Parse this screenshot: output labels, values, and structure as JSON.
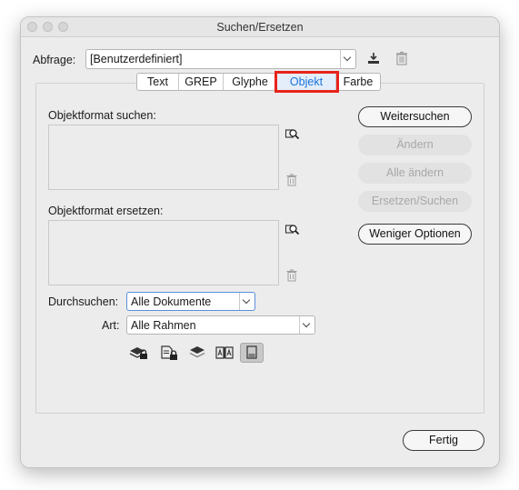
{
  "window": {
    "title": "Suchen/Ersetzen"
  },
  "query": {
    "label": "Abfrage:",
    "value": "[Benutzerdefiniert]"
  },
  "tabs": [
    {
      "label": "Text",
      "active": false
    },
    {
      "label": "GREP",
      "active": false
    },
    {
      "label": "Glyphe",
      "active": false
    },
    {
      "label": "Objekt",
      "active": true
    },
    {
      "label": "Farbe",
      "active": false
    }
  ],
  "find_format": {
    "label": "Objektformat suchen:"
  },
  "replace_format": {
    "label": "Objektformat ersetzen:"
  },
  "buttons": {
    "find_next": "Weitersuchen",
    "change": "Ändern",
    "change_all": "Alle ändern",
    "change_find": "Ersetzen/Suchen",
    "fewer_options": "Weniger Optionen",
    "done": "Fertig"
  },
  "search": {
    "label": "Durchsuchen:",
    "value": "Alle Dokumente"
  },
  "type": {
    "label": "Art:",
    "value": "Alle Rahmen"
  },
  "icons": [
    "save-query-icon",
    "delete-query-icon",
    "specify-find-format-icon",
    "clear-find-format-icon",
    "specify-replace-format-icon",
    "clear-replace-format-icon",
    "include-locked-layers-icon",
    "include-locked-objects-icon",
    "include-hidden-layers-icon",
    "include-master-pages-icon",
    "include-footnotes-icon"
  ],
  "colors": {
    "active_tab_text": "#1a73d9",
    "highlight": "#e8231a",
    "window_bg": "#ececec"
  }
}
